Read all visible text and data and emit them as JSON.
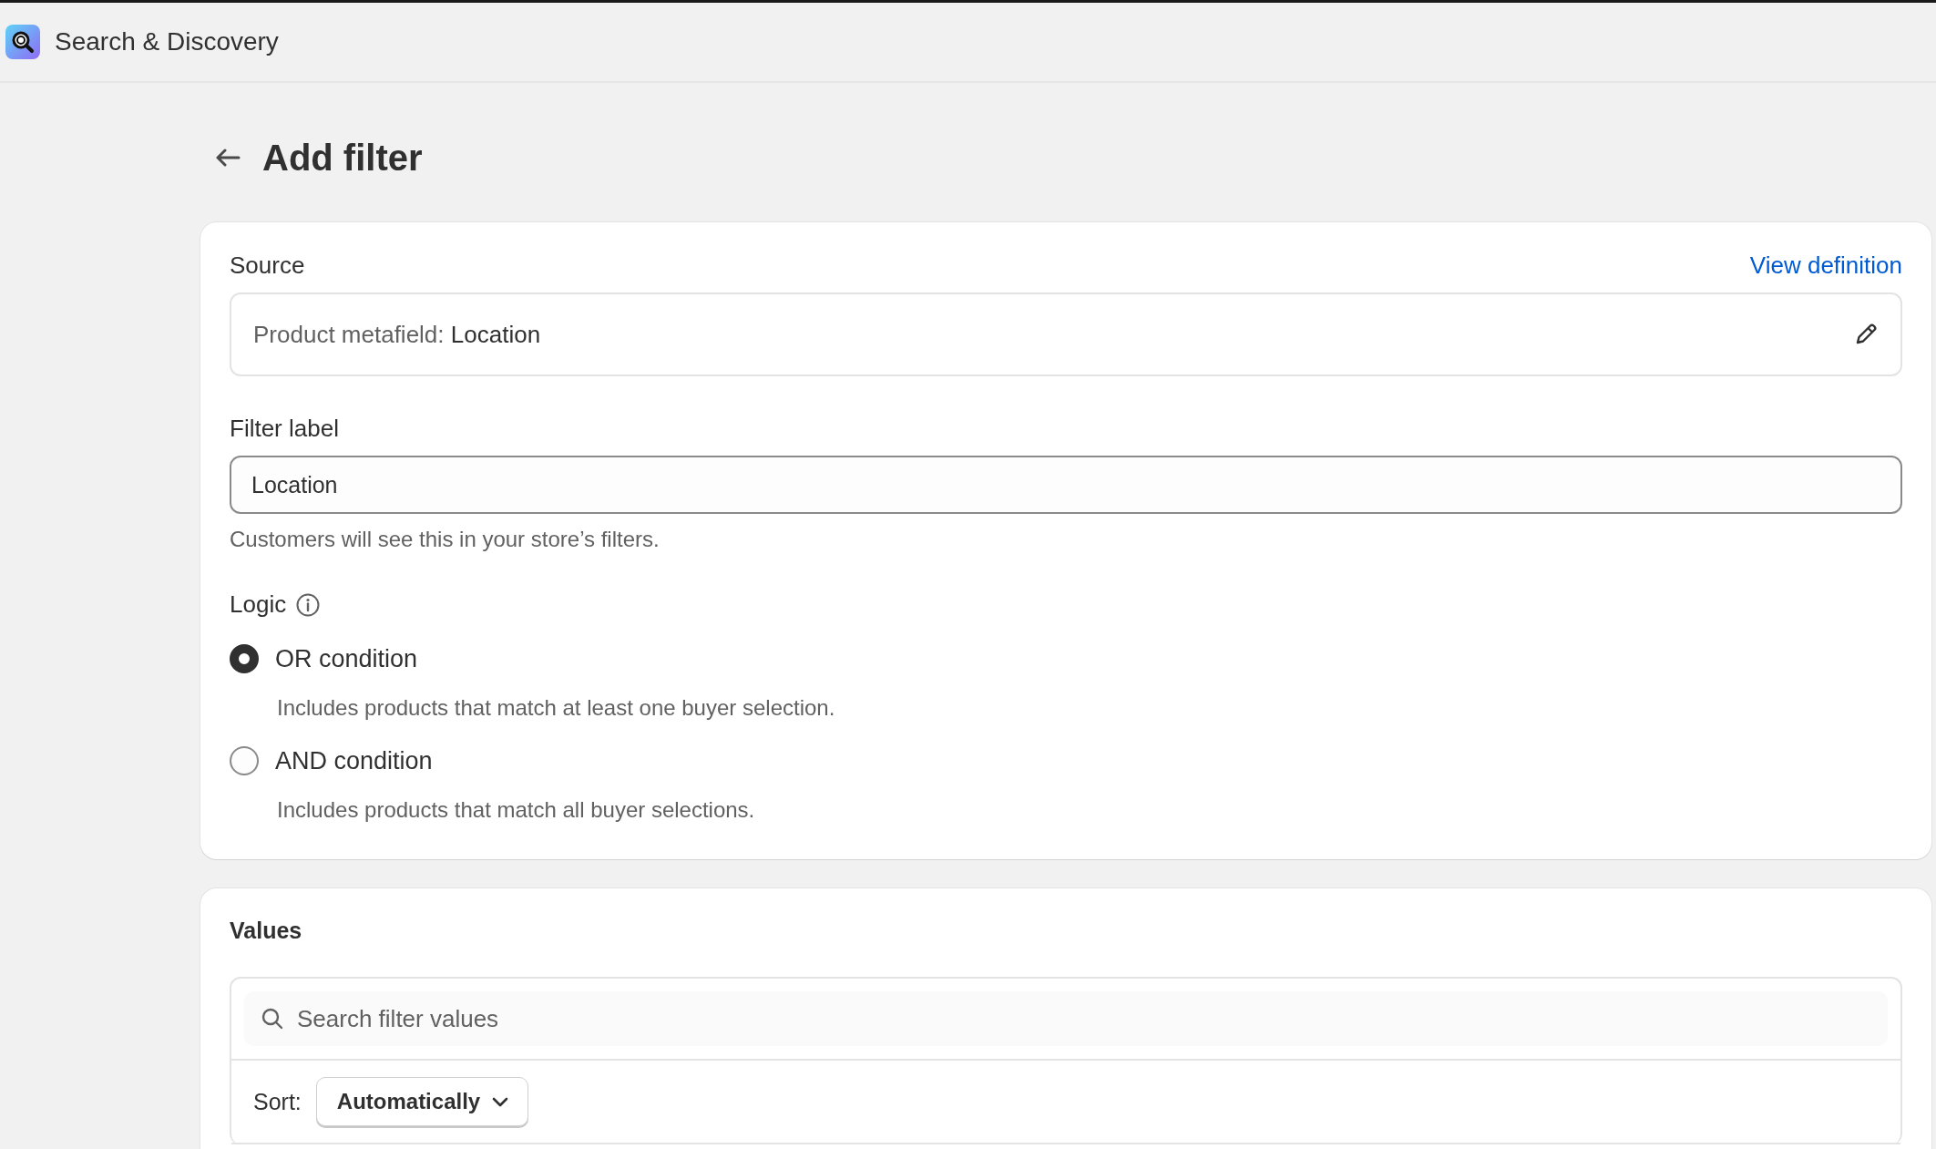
{
  "app_bar": {
    "title": "Search & Discovery"
  },
  "page": {
    "title": "Add filter"
  },
  "source": {
    "label": "Source",
    "link": "View definition",
    "prefix": "Product metafield:",
    "value": "Location"
  },
  "filter_label": {
    "label": "Filter label",
    "value": "Location",
    "help": "Customers will see this in your store’s filters."
  },
  "logic": {
    "label": "Logic",
    "options": [
      {
        "label": "OR condition",
        "description": "Includes products that match at least one buyer selection.",
        "selected": true
      },
      {
        "label": "AND condition",
        "description": "Includes products that match all buyer selections.",
        "selected": false
      }
    ]
  },
  "values": {
    "title": "Values",
    "search": {
      "placeholder": "Search filter values"
    },
    "sort_label": "Sort:",
    "sort_value": "Automatically"
  }
}
